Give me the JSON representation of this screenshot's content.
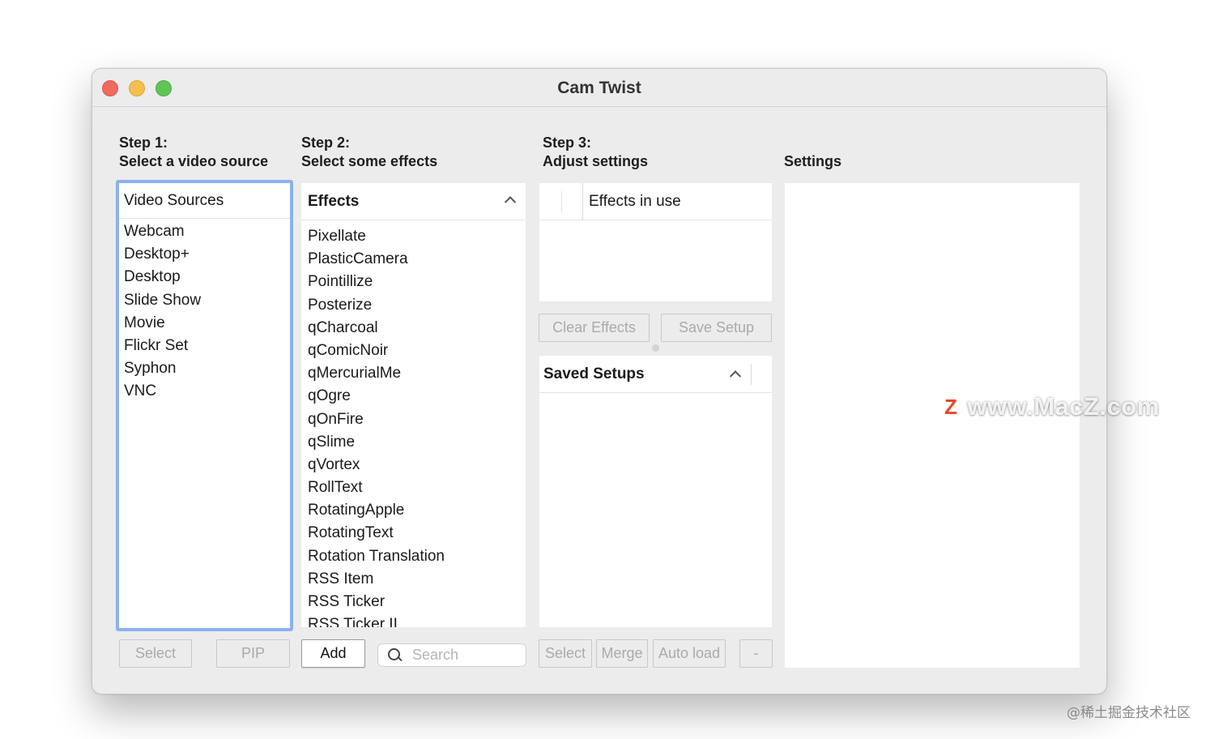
{
  "window": {
    "title": "Cam Twist"
  },
  "steps": {
    "step1": {
      "line1": "Step 1:",
      "line2": "Select a video source"
    },
    "step2": {
      "line1": "Step 2:",
      "line2": "Select some effects"
    },
    "step3": {
      "line1": "Step 3:",
      "line2": "Adjust settings"
    },
    "settings": "Settings"
  },
  "sources": {
    "header": "Video Sources",
    "items": [
      "Webcam",
      "Desktop+",
      "Desktop",
      "Slide Show",
      "Movie",
      "Flickr Set",
      "Syphon",
      "VNC"
    ]
  },
  "effects": {
    "header": "Effects",
    "items": [
      "Pixellate",
      "PlasticCamera",
      "Pointillize",
      "Posterize",
      "qCharcoal",
      "qComicNoir",
      "qMercurialMe",
      "qOgre",
      "qOnFire",
      "qSlime",
      "qVortex",
      "RollText",
      "RotatingApple",
      "RotatingText",
      "Rotation Translation",
      "RSS Item",
      "RSS Ticker",
      "RSS Ticker II"
    ]
  },
  "in_use": {
    "header": "Effects in use"
  },
  "setup_buttons": {
    "clear": "Clear Effects",
    "save": "Save Setup"
  },
  "saved": {
    "header": "Saved Setups"
  },
  "bottom": {
    "select": "Select",
    "pip": "PIP",
    "add": "Add",
    "search_placeholder": "Search",
    "select2": "Select",
    "merge": "Merge",
    "autoload": "Auto load",
    "minus": "-"
  },
  "watermark": {
    "logo": "Z",
    "text": "www.MacZ.com"
  },
  "credit": "@稀土掘金技术社区"
}
